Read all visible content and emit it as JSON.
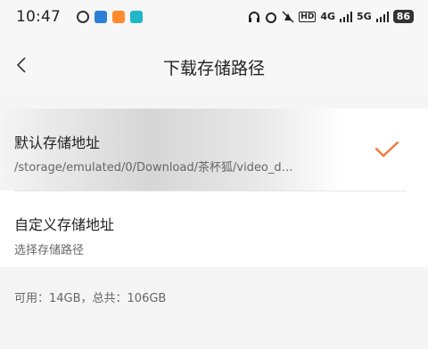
{
  "status_bar": {
    "time": "10:47",
    "signal_1": "4G",
    "signal_2": "5G",
    "battery": "86",
    "icons": [
      "alarm-icon",
      "mute-icon",
      "hd-icon"
    ],
    "app_icon_colors": [
      "#2b7fd8",
      "#ff8a2b",
      "#20b7c8"
    ]
  },
  "nav": {
    "title": "下载存储路径",
    "back_icon": "chevron-left-icon"
  },
  "options": [
    {
      "title": "默认存储地址",
      "subtitle": "/storage/emulated/0/Download/茶杯狐/video_d…",
      "selected": true
    },
    {
      "title": "自定义存储地址",
      "subtitle": "选择存储路径",
      "selected": false
    }
  ],
  "storage": {
    "text": "可用：14GB，总共：106GB"
  },
  "colors": {
    "accent": "#f2783c",
    "background": "#f5f5f5",
    "card": "#ffffff"
  }
}
